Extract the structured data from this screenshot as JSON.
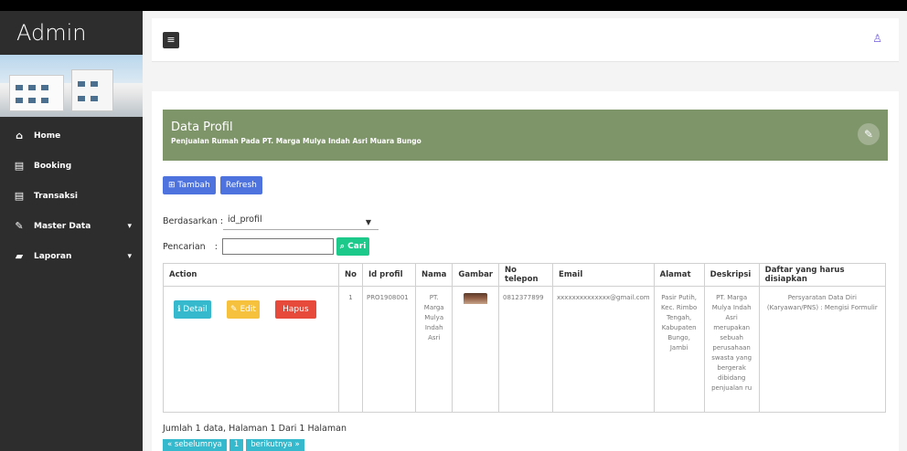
{
  "sidebar": {
    "brand": "Admin",
    "items": [
      {
        "label": "Home",
        "icon": "home-icon"
      },
      {
        "label": "Booking",
        "icon": "database-icon"
      },
      {
        "label": "Transaksi",
        "icon": "database-icon"
      },
      {
        "label": "Master Data",
        "icon": "edit-icon"
      },
      {
        "label": "Laporan",
        "icon": "briefcase-icon"
      }
    ]
  },
  "header": {
    "menu_icon": "≡",
    "user_icon": "user-icon"
  },
  "panel": {
    "title": "Data Profil",
    "subtitle": "Penjualan Rumah Pada PT. Marga Mulya Indah Asri Muara Bungo"
  },
  "toolbar": {
    "add_label": "Tambah",
    "refresh_label": "Refresh"
  },
  "filter": {
    "label": "Berdasarkan :",
    "selected": "id_profil"
  },
  "search": {
    "label": "Pencarian",
    "sep": ":",
    "value": "",
    "button_label": "Cari"
  },
  "table": {
    "headers": [
      "Action",
      "No",
      "Id profil",
      "Nama",
      "Gambar",
      "No telepon",
      "Email",
      "Alamat",
      "Deskripsi",
      "Daftar yang harus disiapkan"
    ],
    "rows": [
      {
        "actions": {
          "detail": "Detail",
          "edit": "Edit",
          "delete": "Hapus"
        },
        "no": "1",
        "id_profil": "PRO1908001",
        "nama": "PT. Marga Mulya Indah Asri",
        "telepon": "0812377899",
        "email": "xxxxxxxxxxxxxx@gmail.com",
        "alamat": "Pasir Putih, Kec. Rimbo Tengah, Kabupaten Bungo, Jambi",
        "deskripsi": "PT. Marga Mulya Indah Asri merupakan sebuah perusahaan swasta yang bergerak dibidang penjualan ru",
        "daftar": "Persyaratan Data Diri (Karyawan/PNS) : Mengisi Formulir"
      }
    ]
  },
  "summary": "Jumlah 1 data, Halaman 1 Dari 1 Halaman",
  "pager": {
    "prev": "« sebelumnya",
    "page": "1",
    "next": "berikutnya »"
  }
}
